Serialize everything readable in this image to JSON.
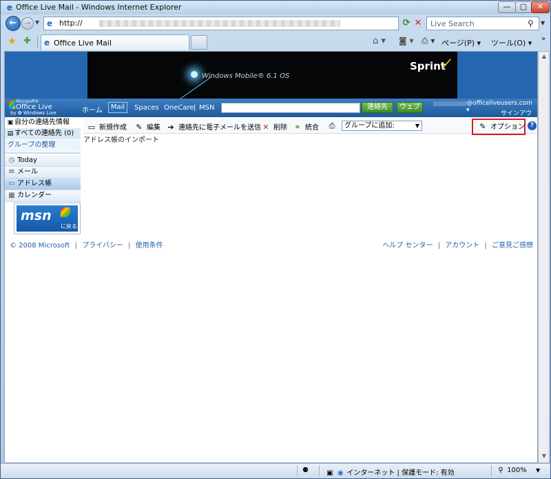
{
  "window": {
    "title": "Office Live Mail - Windows Internet Explorer",
    "min": "—",
    "max": "▢",
    "close": "✕"
  },
  "addressbar": {
    "url": "http://",
    "search_placeholder": "Live Search"
  },
  "tab": {
    "label": "Office Live Mail"
  },
  "commandbar": {
    "page": "ページ(P) ▾",
    "tools": "ツール(O) ▾",
    "more": "»"
  },
  "banner": {
    "product": "Windows Mobile® 6.1 OS",
    "brand": "Sprint"
  },
  "olnav": {
    "logo_microsoft": "Microsoft®",
    "logo_name": "Office Live",
    "logo_by": "by ✿ Windows Live",
    "home": "ホーム",
    "mail": "Mail",
    "spaces": "Spaces",
    "onecare": "OneCare",
    "sep": "|",
    "msn": "MSN",
    "btn_contacts": "連絡先",
    "btn_web": "ウェブ",
    "user_email": "@officeliveusers.com ▾",
    "signout": "サインアウト"
  },
  "sidebar": {
    "my_info": "自分の連絡先情報",
    "all_contacts": "すべての連絡先 (0)",
    "manage_groups": "グループの整理",
    "today": "Today",
    "mail": "メール",
    "address_book": "アドレス帳",
    "calendar": "カレンダー",
    "msn_logo": "msn",
    "msn_back": "に戻る"
  },
  "toolbar": {
    "new": "新規作成",
    "edit": "編集",
    "send_email": "連絡先に電子メールを送信",
    "delete": "削除",
    "merge": "統合",
    "group_select": "グループに追加:",
    "options": "オプション",
    "help": "?"
  },
  "content": {
    "import": "アドレス帳のインポート"
  },
  "footer": {
    "copyright": "© 2008 Microsoft",
    "privacy": "プライバシー",
    "terms": "使用条件",
    "help_center": "ヘルプ センター",
    "account": "アカウント",
    "feedback": "ご意見ご感想",
    "sep": "|"
  },
  "statusbar": {
    "zone": "インターネット | 保護モード: 有効",
    "zoom": "100%"
  }
}
